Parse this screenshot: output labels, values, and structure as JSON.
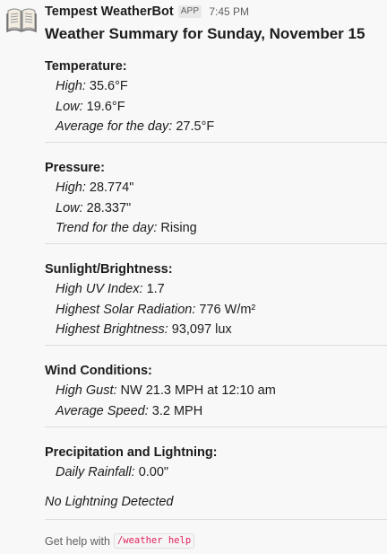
{
  "message": {
    "bot_name": "Tempest WeatherBot",
    "badge": "APP",
    "timestamp": "7:45 PM",
    "title": "Weather Summary for Sunday, November 15",
    "avatar_icon": "open-book-icon"
  },
  "temperature": {
    "heading": "Temperature:",
    "rows": [
      {
        "label": "High:",
        "value": "35.6°F"
      },
      {
        "label": "Low:",
        "value": "19.6°F"
      },
      {
        "label": "Average for the day:",
        "value": "27.5°F"
      }
    ]
  },
  "pressure": {
    "heading": "Pressure:",
    "rows": [
      {
        "label": "High:",
        "value": "28.774\""
      },
      {
        "label": "Low:",
        "value": "28.337\""
      },
      {
        "label": "Trend for the day:",
        "value": "Rising"
      }
    ]
  },
  "sunlight": {
    "heading": "Sunlight/Brightness:",
    "rows": [
      {
        "label": "High UV Index:",
        "value": "1.7"
      },
      {
        "label": "Highest Solar Radiation:",
        "value": "776 W/m²"
      },
      {
        "label": "Highest Brightness:",
        "value": "93,097 lux"
      }
    ]
  },
  "wind": {
    "heading": "Wind Conditions:",
    "rows": [
      {
        "label": "High Gust:",
        "value": "NW 21.3 MPH at 12:10 am"
      },
      {
        "label": "Average Speed:",
        "value": "3.2 MPH"
      }
    ]
  },
  "precipitation": {
    "heading": "Precipitation and Lightning:",
    "rows": [
      {
        "label": "Daily Rainfall:",
        "value": "0.00\""
      }
    ],
    "lightning_note": "No Lightning Detected"
  },
  "help": {
    "text": "Get help with",
    "command": "/weather help"
  },
  "colors": {
    "command_text": "#e01e5a",
    "muted_text": "#616061",
    "divider": "#dddddd"
  }
}
